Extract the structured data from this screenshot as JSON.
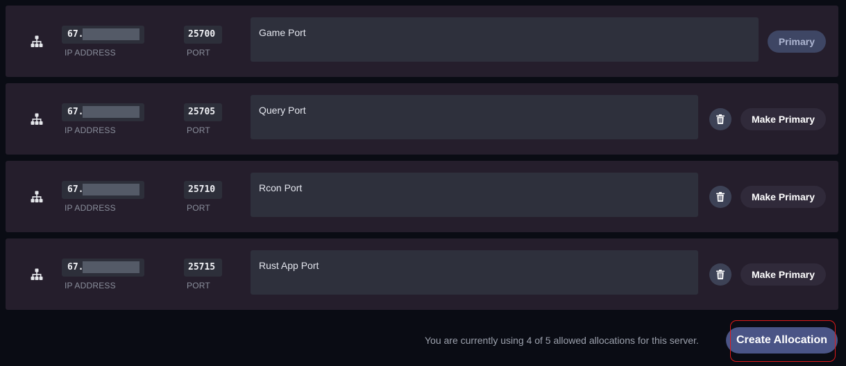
{
  "allocations": [
    {
      "ip": "67.",
      "ip_label": "IP ADDRESS",
      "port": "25700",
      "port_label": "PORT",
      "notes": "Game Port",
      "primary_label": "Primary",
      "is_primary": true,
      "icon": "network-icon"
    },
    {
      "ip": "67.",
      "ip_label": "IP ADDRESS",
      "port": "25705",
      "port_label": "PORT",
      "notes": "Query Port",
      "primary_label": "Make Primary",
      "is_primary": false,
      "icon": "network-icon"
    },
    {
      "ip": "67.",
      "ip_label": "IP ADDRESS",
      "port": "25710",
      "port_label": "PORT",
      "notes": "Rcon Port",
      "primary_label": "Make Primary",
      "is_primary": false,
      "icon": "network-icon"
    },
    {
      "ip": "67.",
      "ip_label": "IP ADDRESS",
      "port": "25715",
      "port_label": "PORT",
      "notes": "Rust App Port",
      "primary_label": "Make Primary",
      "is_primary": false,
      "icon": "network-icon"
    }
  ],
  "footer": {
    "usage_text": "You are currently using 4 of 5 allowed allocations for this server.",
    "create_label": "Create Allocation"
  },
  "colors": {
    "row_background": "#251e2c",
    "accent": "#4a5486",
    "highlight": "#e01919"
  }
}
